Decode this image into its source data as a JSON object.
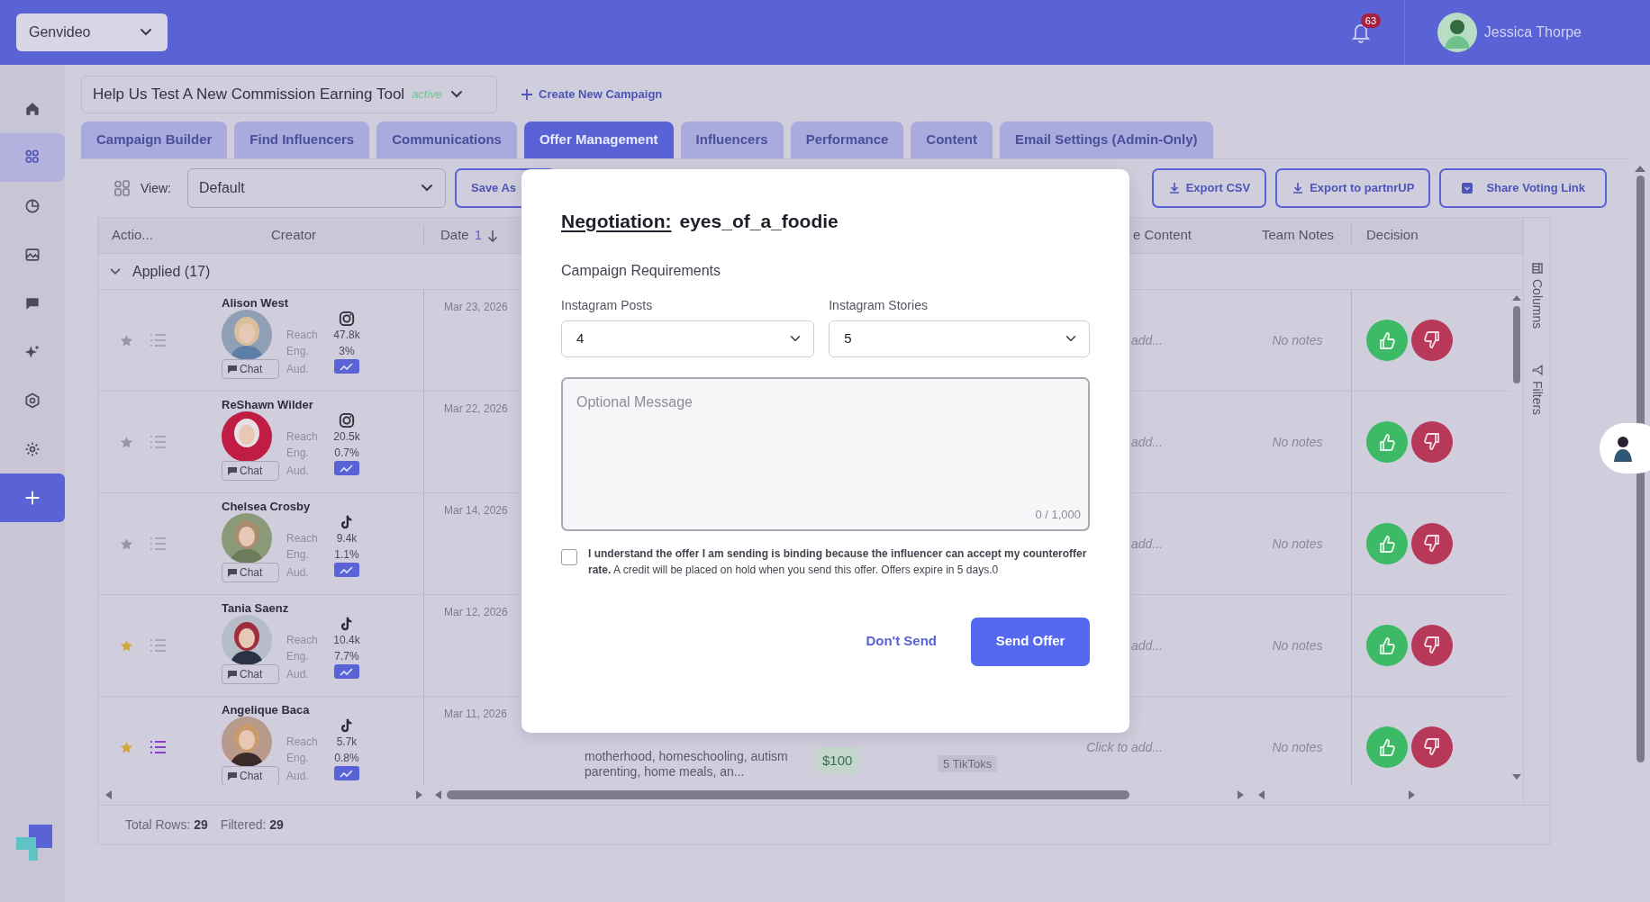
{
  "topbar": {
    "workspace": "Genvideo",
    "notifications": "63",
    "user": "Jessica Thorpe"
  },
  "sidebar": {
    "items": [
      {
        "kind": "link",
        "selected": false
      },
      {
        "kind": "link",
        "selected": true
      },
      {
        "kind": "link",
        "selected": false
      },
      {
        "kind": "link",
        "selected": false
      },
      {
        "kind": "link",
        "selected": false
      },
      {
        "kind": "link",
        "selected": false
      },
      {
        "kind": "link",
        "selected": false
      },
      {
        "kind": "link",
        "selected": false
      },
      {
        "kind": "add",
        "selected": false
      }
    ]
  },
  "campaign": {
    "name": "Help Us Test A New Commission Earning Tool",
    "status": "active",
    "create_label": "Create New Campaign"
  },
  "tabs": [
    {
      "label": "Campaign Builder",
      "selected": false
    },
    {
      "label": "Find Influencers",
      "selected": false
    },
    {
      "label": "Communications",
      "selected": false
    },
    {
      "label": "Offer Management",
      "selected": true
    },
    {
      "label": "Influencers",
      "selected": false
    },
    {
      "label": "Performance",
      "selected": false
    },
    {
      "label": "Content",
      "selected": false
    },
    {
      "label": "Email Settings (Admin-Only)",
      "selected": false
    }
  ],
  "toolbar": {
    "view_label": "View:",
    "view_value": "Default",
    "save_label": "Save As",
    "buttons": [
      "Export CSV",
      "Export to partnrUP",
      "Share Voting Link"
    ]
  },
  "grid": {
    "columns": {
      "actions": "Actio...",
      "creator": "Creator",
      "date": "Date",
      "date_sort": "1",
      "content": "e Content",
      "notes": "Team Notes",
      "decision": "Decision"
    },
    "group": {
      "label": "Applied (17)",
      "expanded": true
    },
    "rows": [
      {
        "starred": false,
        "listed": false,
        "name": "Alison West",
        "kind": "instagram",
        "reach_label": "Reach",
        "reach": "47.8k",
        "eng_label": "Eng.",
        "eng": "3%",
        "aud_label": "Aud.",
        "chat_label": "Chat",
        "date": "Mar 23, 2026",
        "content": "add...",
        "notes": "No notes"
      },
      {
        "starred": false,
        "listed": false,
        "name": "ReShawn Wilder",
        "kind": "instagram",
        "reach_label": "Reach",
        "reach": "20.5k",
        "eng_label": "Eng.",
        "eng": "0.7%",
        "aud_label": "Aud.",
        "chat_label": "Chat",
        "date": "Mar 22, 2026",
        "content": "add...",
        "notes": "No notes"
      },
      {
        "starred": false,
        "listed": false,
        "name": "Chelsea Crosby",
        "kind": "tiktok",
        "reach_label": "Reach",
        "reach": "9.4k",
        "eng_label": "Eng.",
        "eng": "1.1%",
        "aud_label": "Aud.",
        "chat_label": "Chat",
        "date": "Mar 14, 2026",
        "content": "add...",
        "notes": "No notes"
      },
      {
        "starred": true,
        "listed": false,
        "name": "Tania Saenz",
        "kind": "tiktok",
        "reach_label": "Reach",
        "reach": "10.4k",
        "eng_label": "Eng.",
        "eng": "7.7%",
        "aud_label": "Aud.",
        "chat_label": "Chat",
        "date": "Mar 12, 2026",
        "content": "add...",
        "notes": "No notes"
      },
      {
        "starred": true,
        "listed": true,
        "name": "Angelique Baca",
        "kind": "tiktok",
        "reach_label": "Reach",
        "reach": "5.7k",
        "eng_label": "Eng.",
        "eng": "0.8%",
        "aud_label": "Aud.",
        "chat_label": "Chat",
        "date": "Mar 11, 2026",
        "niches": "motherhood, homeschooling, autism parenting, home meals, an...",
        "rate": "$100",
        "deliverables": "5 TikToks",
        "content": "Click to add...",
        "notes": "No notes"
      }
    ],
    "side_panel": [
      "Columns",
      "Filters"
    ],
    "footer": {
      "total": "Total Rows: **29**",
      "filtered": "Filtered: **29**"
    }
  },
  "modal": {
    "title_label": "Negotiation:",
    "title_value": "eyes_of_a_foodie",
    "section": "Campaign Requirements",
    "fields": [
      {
        "label": "Instagram Posts",
        "value": "4"
      },
      {
        "label": "Instagram Stories",
        "value": "5"
      }
    ],
    "message": {
      "placeholder": "Optional Message",
      "counter": "0 / 1,000"
    },
    "consent": {
      "checked": false,
      "text": "**I understand the offer I am sending is binding because the influencer can accept my counteroffer rate.** A credit will be placed on hold when you send this offer. Offers expire in 5 days.0"
    },
    "cancel": "Don't Send",
    "submit": "Send Offer"
  }
}
